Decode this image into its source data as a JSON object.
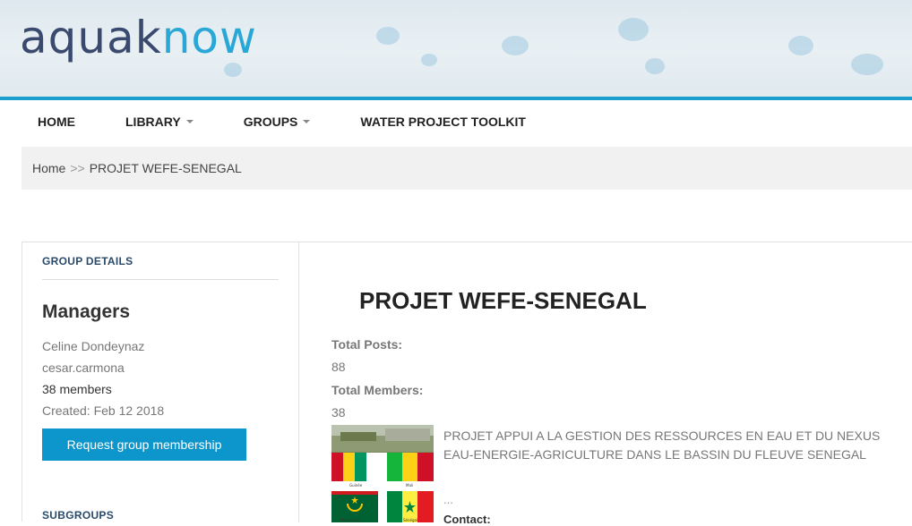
{
  "brand": {
    "logo_part1": "aqua",
    "logo_k": "k",
    "logo_part2": "now",
    "accent_color": "#1a9fcc",
    "logo_dark_color": "#3a4a6e"
  },
  "nav": {
    "items": [
      {
        "label": "HOME",
        "has_caret": false
      },
      {
        "label": "LIBRARY",
        "has_caret": true
      },
      {
        "label": "GROUPS",
        "has_caret": true
      },
      {
        "label": "WATER PROJECT TOOLKIT",
        "has_caret": false
      }
    ]
  },
  "breadcrumb": {
    "home": "Home",
    "separator": ">>",
    "current": "PROJET WEFE-SENEGAL"
  },
  "sidebar": {
    "group_details_heading": "GROUP DETAILS",
    "managers_title": "Managers",
    "managers": [
      "Celine Dondeynaz",
      "cesar.carmona"
    ],
    "members": "38 members",
    "created": "Created: Feb 12 2018",
    "request_button": "Request group membership",
    "subgroups_heading": "SUBGROUPS",
    "button_color": "#0c96cc"
  },
  "main": {
    "title": "PROJET WEFE-SENEGAL",
    "total_posts_label": "Total Posts:",
    "total_posts": "88",
    "total_members_label": "Total Members:",
    "total_members": "38",
    "description": "PROJET APPUI A LA GESTION DES RESSOURCES EN EAU ET DU NEXUS EAU-ENERGIE-AGRICULTURE DANS LE BASSIN DU FLEUVE SENEGAL",
    "ellipsis": "...",
    "contact_label": "Contact:",
    "thumbnail_flag_labels": [
      "Guinée",
      "Mali",
      "Mauritanie",
      "Sénégal"
    ]
  }
}
